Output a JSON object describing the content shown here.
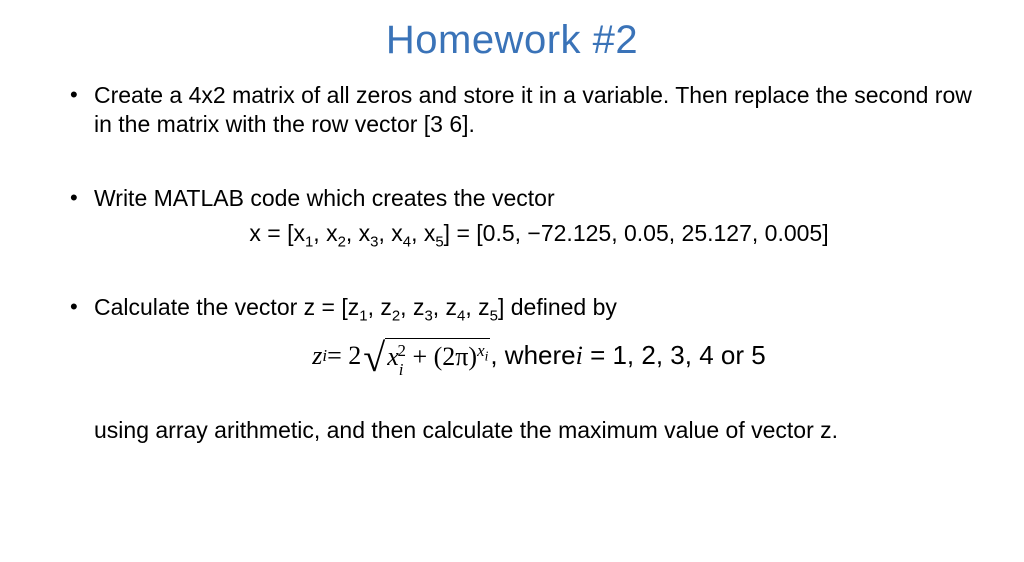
{
  "title": "Homework #2",
  "bullets": {
    "b1": "Create a 4x2 matrix of all zeros and store it in a variable. Then replace the second row in the matrix with the row vector [3 6].",
    "b2": "Write MATLAB code which creates the vector",
    "b3_lead": "Calculate the vector z = [z",
    "b3_after_list": "] defined by"
  },
  "vector_eq": {
    "lhs_x": "x = [x",
    "rhs": "] = [0.5, −72.125, 0.05, 25.127, 0.005]"
  },
  "z_formula": {
    "lead": "z",
    "eq2": " = 2",
    "radicand_x": "x",
    "plus": " + ",
    "twopi": "(2π)",
    "where": " , where ",
    "ieq": "i = 1, 2, 3, 4 or 5"
  },
  "continuation": "using array arithmetic, and then calculate the maximum value of vector z.",
  "sep": ", "
}
